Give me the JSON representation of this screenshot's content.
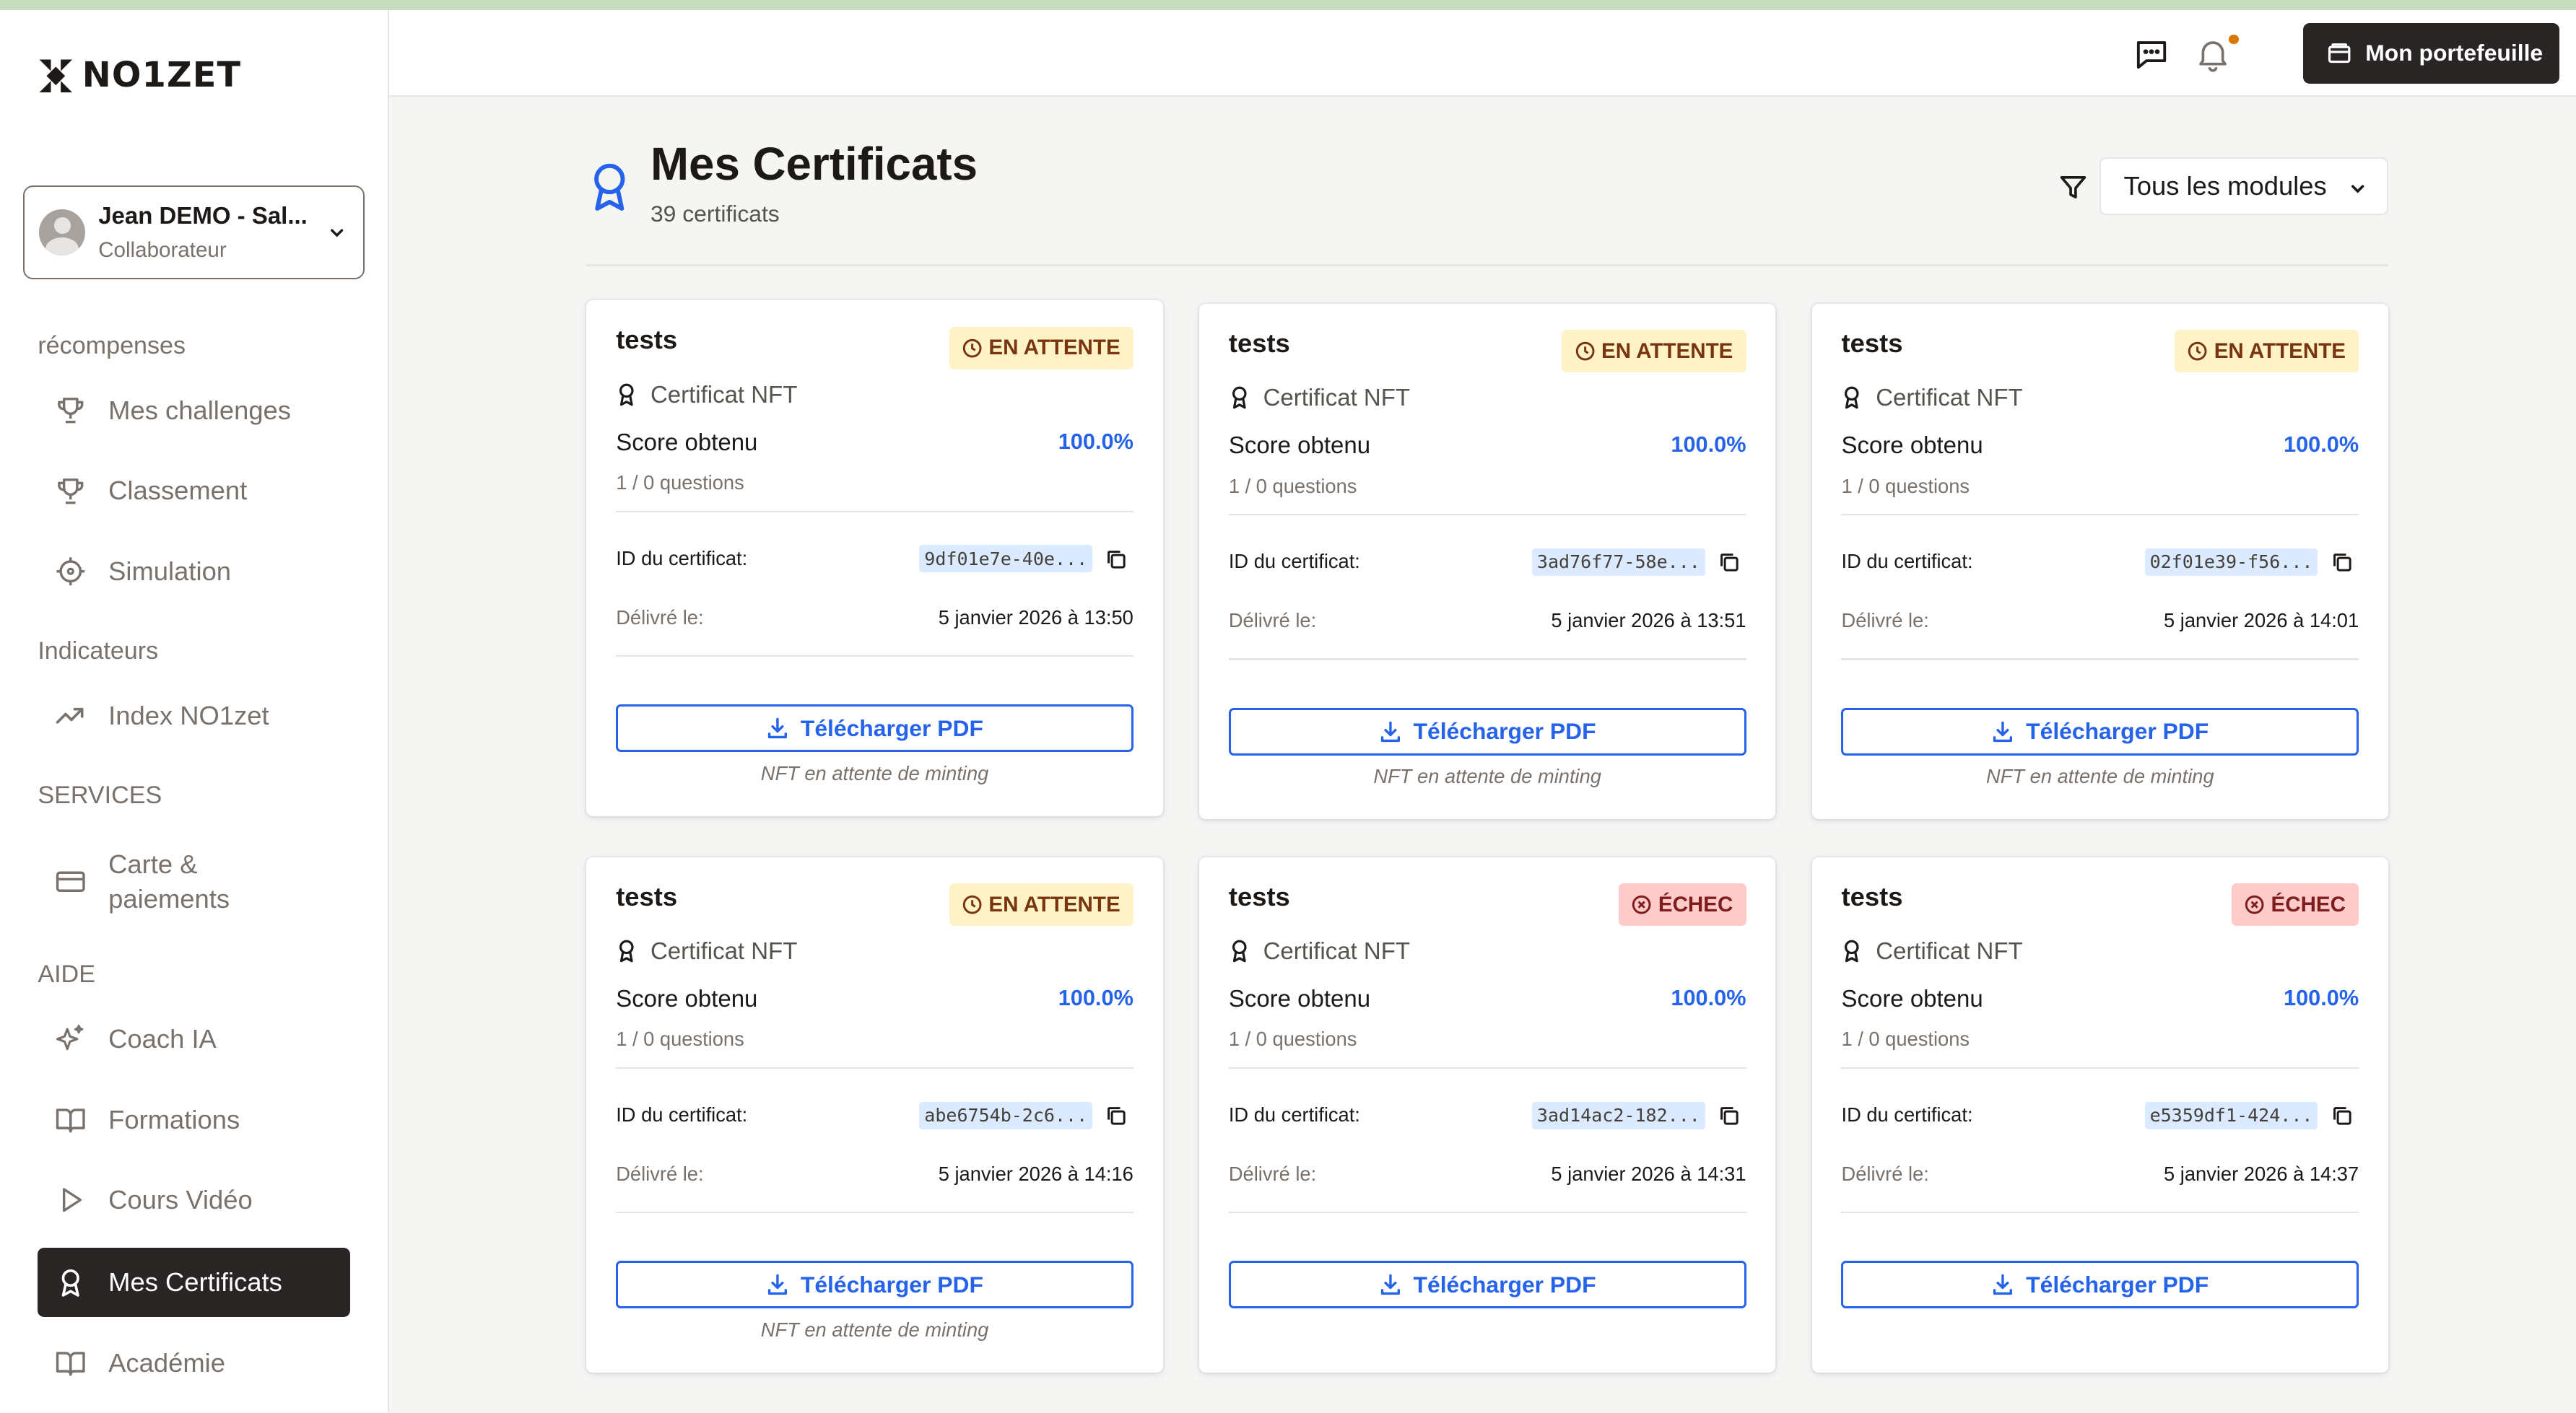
{
  "app": {
    "brand": "NO1ZET"
  },
  "user": {
    "name": "Jean DEMO - Sal...",
    "role": "Collaborateur"
  },
  "sidebar": {
    "sections": [
      {
        "title": "récompenses",
        "items": [
          {
            "label": "Mes challenges",
            "icon": "trophy-icon"
          },
          {
            "label": "Classement",
            "icon": "trophy-icon"
          },
          {
            "label": "Simulation",
            "icon": "crosshair-icon"
          }
        ]
      },
      {
        "title": "Indicateurs",
        "items": [
          {
            "label": "Index NO1zet",
            "icon": "trending-up-icon"
          }
        ]
      },
      {
        "title": "SERVICES",
        "items": [
          {
            "label": "Carte & paiements",
            "icon": "credit-card-icon"
          }
        ]
      },
      {
        "title": "AIDE",
        "items": [
          {
            "label": "Coach IA",
            "icon": "sparkles-icon"
          },
          {
            "label": "Formations",
            "icon": "book-open-icon"
          },
          {
            "label": "Cours Vidéo",
            "icon": "play-icon"
          },
          {
            "label": "Mes Certificats",
            "icon": "award-icon",
            "active": true
          },
          {
            "label": "Académie",
            "icon": "book-open-icon"
          }
        ]
      }
    ]
  },
  "header": {
    "wallet_label": "Mon portefeuille"
  },
  "page": {
    "title": "Mes Certificats",
    "count": "39 certificats",
    "filter": {
      "selected": "Tous les modules"
    }
  },
  "labels": {
    "cert_type": "Certificat NFT",
    "score": "Score obtenu",
    "id": "ID du certificat:",
    "issued": "Délivré le:",
    "download": "Télécharger PDF",
    "mint_note": "NFT en attente de minting"
  },
  "colors": {
    "accent": "#2563eb",
    "dark": "#292524",
    "pending_bg": "#fef3c7",
    "fail_bg": "#fecaca"
  },
  "certificates": [
    {
      "title": "tests",
      "status": "EN ATTENTE",
      "status_type": "pending",
      "score": "100.0%",
      "questions": "1 / 0 questions",
      "id": "9df01e7e-40e...",
      "date": "5 janvier 2026 à 13:50",
      "note": true
    },
    {
      "title": "tests",
      "status": "EN ATTENTE",
      "status_type": "pending",
      "score": "100.0%",
      "questions": "1 / 0 questions",
      "id": "3ad76f77-58e...",
      "date": "5 janvier 2026 à 13:51",
      "note": true
    },
    {
      "title": "tests",
      "status": "EN ATTENTE",
      "status_type": "pending",
      "score": "100.0%",
      "questions": "1 / 0 questions",
      "id": "02f01e39-f56...",
      "date": "5 janvier 2026 à 14:01",
      "note": true
    },
    {
      "title": "tests",
      "status": "EN ATTENTE",
      "status_type": "pending",
      "score": "100.0%",
      "questions": "1 / 0 questions",
      "id": "abe6754b-2c6...",
      "date": "5 janvier 2026 à 14:16",
      "note": true
    },
    {
      "title": "tests",
      "status": "ÉCHEC",
      "status_type": "fail",
      "score": "100.0%",
      "questions": "1 / 0 questions",
      "id": "3ad14ac2-182...",
      "date": "5 janvier 2026 à 14:31",
      "note": false
    },
    {
      "title": "tests",
      "status": "ÉCHEC",
      "status_type": "fail",
      "score": "100.0%",
      "questions": "1 / 0 questions",
      "id": "e5359df1-424...",
      "date": "5 janvier 2026 à 14:37",
      "note": false
    }
  ]
}
